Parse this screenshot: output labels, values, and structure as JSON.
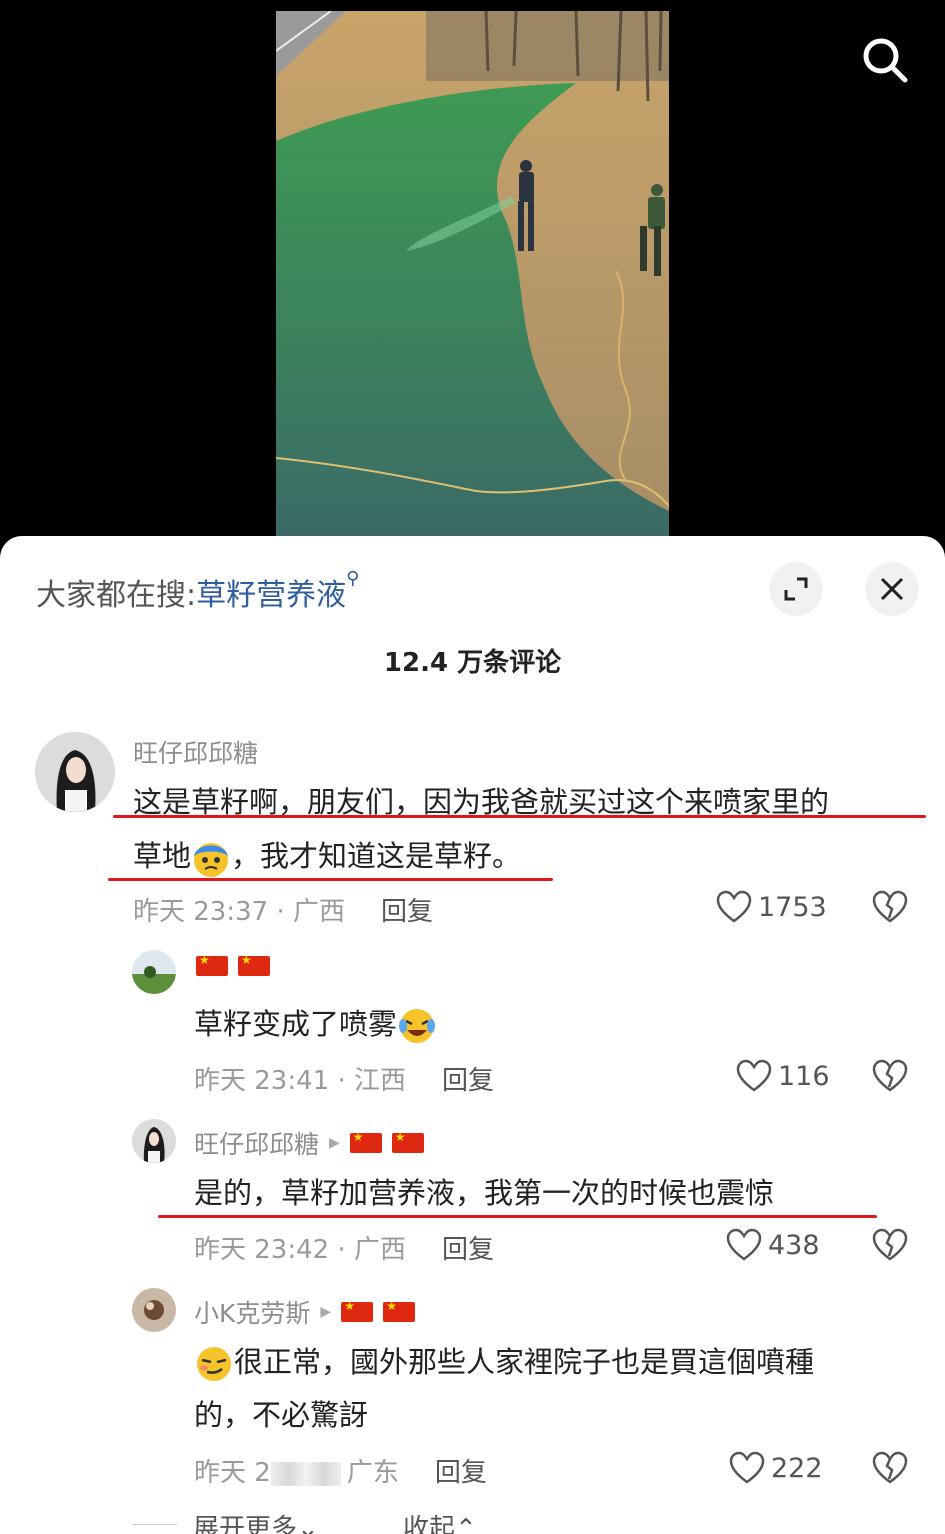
{
  "search_bar": {
    "prefix": "大家都在搜:",
    "term": "草籽营养液"
  },
  "comment_count": "12.4 万条评论",
  "comments": [
    {
      "user": "旺仔邱邱糖",
      "text_line1": "这是草籽啊，朋友们，因为我爸就买过这个来喷家里的",
      "text_line2a": "草地",
      "text_line2b": "，我才知道这是草籽。",
      "time": "昨天 23:37 · 广西",
      "reply_label": "回复",
      "likes": "1753"
    },
    {
      "user": "",
      "text": "草籽变成了喷雾",
      "time": "昨天 23:41 · 江西",
      "reply_label": "回复",
      "likes": "116"
    },
    {
      "user": "旺仔邱邱糖",
      "text": "是的，草籽加营养液，我第一次的时候也震惊",
      "time": "昨天 23:42 · 广西",
      "reply_label": "回复",
      "likes": "438"
    },
    {
      "user": "小K克劳斯",
      "text_line1": "很正常，國外那些人家裡院子也是買這個噴種",
      "text_line2": "的，不必驚訝",
      "time_a": "昨天 2",
      "time_b": "广东",
      "reply_label": "回复",
      "likes": "222"
    }
  ],
  "footer": {
    "expand_more": "展开更多⌄",
    "collapse": "收起⌃"
  }
}
